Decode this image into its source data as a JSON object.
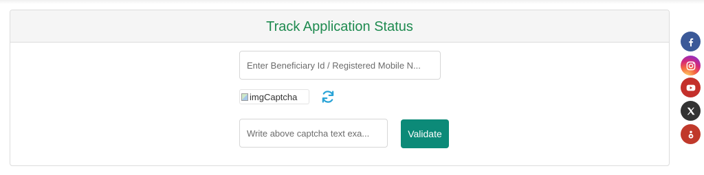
{
  "header": {
    "title": "Track Application Status"
  },
  "form": {
    "beneficiary_placeholder": "Enter Beneficiary Id / Registered Mobile N...",
    "captcha_alt": "imgCaptcha",
    "captcha_placeholder": "Write above captcha text exa...",
    "validate_label": "Validate"
  },
  "icons": {
    "refresh": "refresh-icon",
    "social": [
      "facebook-icon",
      "instagram-icon",
      "youtube-icon",
      "x-icon",
      "koo-icon"
    ]
  },
  "colors": {
    "title": "#1e8a4f",
    "validate_button": "#0c8a78",
    "refresh_icon": "#29a3d6",
    "facebook": "#3b5998",
    "youtube": "#c4302b",
    "x": "#333333",
    "koo": "#c0392b"
  }
}
